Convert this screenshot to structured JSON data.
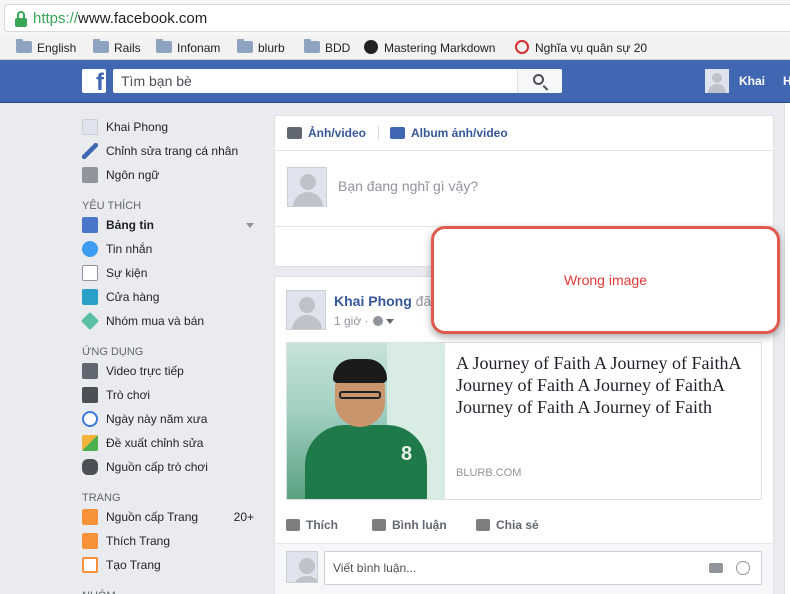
{
  "browser": {
    "url_scheme": "https://",
    "url_host": "www.facebook.com",
    "bookmarks": [
      {
        "label": "English",
        "icon": "folder-icon"
      },
      {
        "label": "Rails",
        "icon": "folder-icon"
      },
      {
        "label": "Infonam",
        "icon": "folder-icon"
      },
      {
        "label": "blurb",
        "icon": "folder-icon"
      },
      {
        "label": "BDD",
        "icon": "folder-icon"
      },
      {
        "label": "Mastering Markdown",
        "icon": "github-icon"
      },
      {
        "label": "Nghĩa vụ quân sự 20",
        "icon": "site-icon"
      }
    ]
  },
  "topbar": {
    "logo": "f",
    "search_placeholder": "Tìm bạn bè",
    "user_name": "Khai",
    "next_nav": "H"
  },
  "sidebar": {
    "profile": [
      {
        "label": "Khai Phong",
        "icon": "avatar-icon"
      },
      {
        "label": "Chỉnh sửa trang cá nhân",
        "icon": "pencil-icon"
      },
      {
        "label": "Ngôn ngữ",
        "icon": "language-icon"
      }
    ],
    "favorites_heading": "YÊU THÍCH",
    "favorites": [
      {
        "label": "Bảng tin",
        "icon": "news-feed-icon"
      },
      {
        "label": "Tin nhắn",
        "icon": "messages-icon"
      },
      {
        "label": "Sự kiện",
        "icon": "calendar-icon"
      },
      {
        "label": "Cửa hàng",
        "icon": "shop-icon"
      },
      {
        "label": "Nhóm mua và bán",
        "icon": "tag-icon"
      }
    ],
    "apps_heading": "ỨNG DỤNG",
    "apps": [
      {
        "label": "Video trực tiếp",
        "icon": "live-video-icon"
      },
      {
        "label": "Trò chơi",
        "icon": "games-icon"
      },
      {
        "label": "Ngày này năm xưa",
        "icon": "memories-icon"
      },
      {
        "label": "Đề xuất chỉnh sửa",
        "icon": "check-icon"
      },
      {
        "label": "Nguồn cấp trò chơi",
        "icon": "gamepad-icon"
      }
    ],
    "pages_heading": "TRANG",
    "pages": [
      {
        "label": "Nguồn cấp Trang",
        "icon": "pages-feed-icon",
        "count": "20+"
      },
      {
        "label": "Thích Trang",
        "icon": "like-page-icon"
      },
      {
        "label": "Tạo Trang",
        "icon": "create-page-icon"
      }
    ],
    "groups_heading": "NHÓM"
  },
  "composer": {
    "tab_photo": "Ảnh/video",
    "tab_album": "Album ảnh/video",
    "placeholder": "Bạn đang nghĩ gì vậy?"
  },
  "post": {
    "author": "Khai Phong",
    "author_suffix": "đã",
    "time": "1 giờ ·",
    "link_title": "A Journey of Faith A Journey of FaithA Journey of Faith A Journey of FaithA Journey of Faith A Journey of Faith",
    "link_domain": "BLURB.COM",
    "like": "Thích",
    "comment": "Bình luận",
    "share": "Chia sẻ",
    "comment_placeholder": "Viết bình luận..."
  },
  "overlay": {
    "message": "Wrong image"
  },
  "colors": {
    "fb_blue": "#4267b2",
    "link_blue": "#365899",
    "overlay_border": "#e05a4d",
    "overlay_text": "#e53935",
    "secure_green": "#3aa757"
  }
}
